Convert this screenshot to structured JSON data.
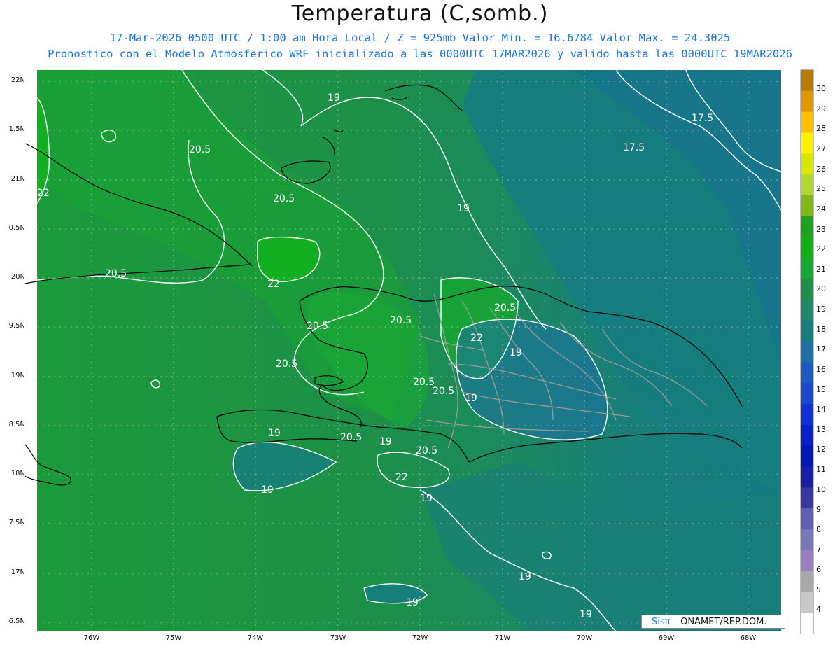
{
  "title": "Temperatura (C,somb.)",
  "subtitle_line1": "17-Mar-2026  0500 UTC / 1:00 am Hora Local / Z = 925mb    Valor Min. = 16.6784  Valor Max. = 24.3025",
  "subtitle_line2": "Pronostico con el Modelo Atmosferico WRF inicializado a las 0000UTC_17MAR2026 y valido hasta las  0000UTC_19MAR2026",
  "lat_labels": [
    "22N",
    "1.5N",
    "21N",
    "0.5N",
    "20N",
    "9.5N",
    "19N",
    "8.5N",
    "18N",
    "7.5N",
    "17N",
    "6.5N"
  ],
  "lon_labels": [
    "76W",
    "75W",
    "74W",
    "73W",
    "72W",
    "71W",
    "70W",
    "69W",
    "68W"
  ],
  "colorbar_labels": [
    "30",
    "29",
    "28",
    "27",
    "26",
    "25",
    "24",
    "23",
    "22",
    "21",
    "20",
    "19",
    "18",
    "17",
    "16",
    "15",
    "14",
    "13",
    "12",
    "11",
    "10",
    "9",
    "8",
    "7",
    "6",
    "5",
    "4"
  ],
  "colorbar_colors": [
    "#b87a00",
    "#e09800",
    "#ffc000",
    "#fff000",
    "#d8e800",
    "#b0d830",
    "#80b818",
    "#20a020",
    "#10b010",
    "#18a838",
    "#208f48",
    "#1f8a6a",
    "#167d80",
    "#1d6fa4",
    "#1c5cc0",
    "#1848d0",
    "#1030d8",
    "#0a20c8",
    "#0018b8",
    "#1820a8",
    "#3838a0",
    "#6060b0",
    "#7878b8",
    "#9880c0",
    "#a8a8a8",
    "#c8c8c8",
    "#ffffff"
  ],
  "contour_labels": [
    "19",
    "17.5",
    "17.5",
    "20.5",
    "20.5",
    "22",
    "19",
    "20.5",
    "22",
    "20.5",
    "20.5",
    "20.5",
    "22",
    "19",
    "20.5",
    "20.5",
    "19",
    "20.5",
    "19",
    "20.5",
    "19",
    "20.5",
    "19",
    "19",
    "19",
    "19",
    "19",
    "22"
  ],
  "credit_sis": "Sisπ",
  "credit_org": "– ONAMET/REP.DOM."
}
